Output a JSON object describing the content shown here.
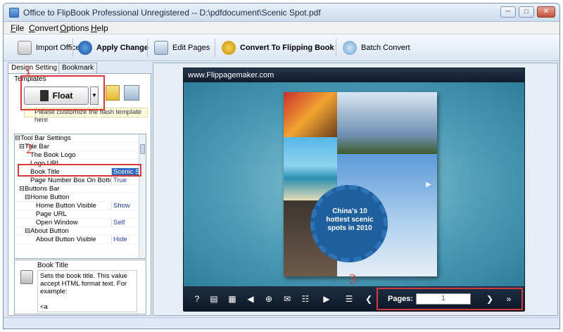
{
  "window": {
    "title": "Office to FlipBook Professional Unregistered -- D:\\pdfdocument\\Scenic Spot.pdf",
    "controls": {
      "minimize": "─",
      "maximize": "□",
      "close": "✕"
    }
  },
  "menu": {
    "items": [
      {
        "label": "File",
        "hotkey": "F",
        "rest": "ile"
      },
      {
        "label": "Convert",
        "hotkey": "C",
        "rest": "onvert"
      },
      {
        "label": "Options",
        "hotkey": "O",
        "rest": "ptions"
      },
      {
        "label": "Help",
        "hotkey": "H",
        "rest": "elp"
      }
    ]
  },
  "toolbar": {
    "import_label": "Import Office",
    "apply_label": "Apply Change",
    "edit_label": "Edit Pages",
    "convert_label": "Convert To Flipping Book",
    "batch_label": "Batch Convert"
  },
  "left": {
    "tabs": {
      "design": "Design Setting",
      "bookmark": "Bookmark"
    },
    "templates_label": "Templates",
    "template_name": "Float",
    "template_hint": "Please customize the flash template here",
    "properties": [
      {
        "name": "⊟Tool Bar Settings",
        "value": "",
        "indent": 0
      },
      {
        "name": "⊟Title Bar",
        "value": "",
        "indent": 1
      },
      {
        "name": "The Book Logo",
        "value": "",
        "indent": 3
      },
      {
        "name": "Logo URL",
        "value": "",
        "indent": 3
      },
      {
        "name": "Book Title",
        "value": "Scenic Spot",
        "indent": 3
      },
      {
        "name": "Page Number Box On Bottom",
        "value": "True",
        "indent": 3
      },
      {
        "name": "⊟Buttons Bar",
        "value": "",
        "indent": 1
      },
      {
        "name": "⊟Home Button",
        "value": "",
        "indent": 2
      },
      {
        "name": "Home Button Visible",
        "value": "Show",
        "indent": 4
      },
      {
        "name": "Page URL",
        "value": "",
        "indent": 4
      },
      {
        "name": "Open Window",
        "value": "Self",
        "indent": 4
      },
      {
        "name": "⊟About Button",
        "value": "",
        "indent": 2
      },
      {
        "name": "About Button Visible",
        "value": "Hide",
        "indent": 4
      }
    ],
    "desc_title": "Book Title",
    "desc_text": "Sets the book title. This value accept HTML format text. For example:\n\n<a href='http://www.Flippagemaker.com'"
  },
  "preview": {
    "site": "www.Flippagemaker.com",
    "book_caption": "China's 10 hottest scenic spots in 2010",
    "pages_label": "Pages:",
    "page_value": "1"
  },
  "annotations": {
    "n1": "1",
    "n2": "2",
    "n3": "3"
  },
  "colors": {
    "accent_red": "#d63a3a",
    "viewer_bg": "#1a3451",
    "gear_blue": "#1f5f9d"
  }
}
